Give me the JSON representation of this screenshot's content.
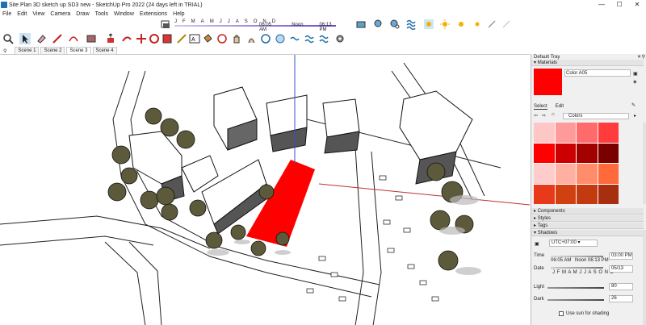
{
  "window": {
    "title": "Site Plan 3D sketch up SD3 new - SketchUp Pro 2022 (24 days left in TRIAL)",
    "minimize": "—",
    "maximize": "☐",
    "close": "✕"
  },
  "menu": [
    "File",
    "Edit",
    "View",
    "Camera",
    "Draw",
    "Tools",
    "Window",
    "Extensions",
    "Help"
  ],
  "shadow_toolbar": {
    "months": [
      "J",
      "F",
      "M",
      "A",
      "M",
      "J",
      "J",
      "A",
      "S",
      "O",
      "N",
      "D"
    ],
    "sunrise": "06:05 AM",
    "noon": "Noon",
    "sunset": "06:13 PM"
  },
  "scenes": {
    "tabs": [
      "Scene 1",
      "Scene 2",
      "Scene 3",
      "Scene 4"
    ],
    "active_index": 2
  },
  "tray": {
    "title": "Default Tray",
    "materials_header": "Materials",
    "material_name": "Color A05",
    "material_color": "#ff0000",
    "tab_select": "Select",
    "tab_edit": "Edit",
    "library": "Colors",
    "swatches": [
      "#ffc6c6",
      "#ff9a9a",
      "#ff6a6a",
      "#ff3b3b",
      "#ff0000",
      "#cc0000",
      "#a30000",
      "#7a0000",
      "#ffcccc",
      "#ffb0a0",
      "#ff8c6a",
      "#ff6a3a",
      "#e83a1a",
      "#d04010",
      "#c33a10",
      "#a82e10"
    ],
    "components_header": "Components",
    "styles_header": "Styles",
    "tags_header": "Tags",
    "shadows_header": "Shadows",
    "timezone": "UTC+07:00",
    "time_label": "Time",
    "time_value": "03:00 PM",
    "time_start": "06:05 AM",
    "time_noon": "Noon",
    "time_end": "06:13 PM",
    "date_label": "Date",
    "date_value": "05/13",
    "date_months": "J F M A M J J A S O N D",
    "light_label": "Light",
    "light_value": "80",
    "dark_label": "Dark",
    "dark_value": "26",
    "sun_shading_label": "Use sun for shading"
  }
}
